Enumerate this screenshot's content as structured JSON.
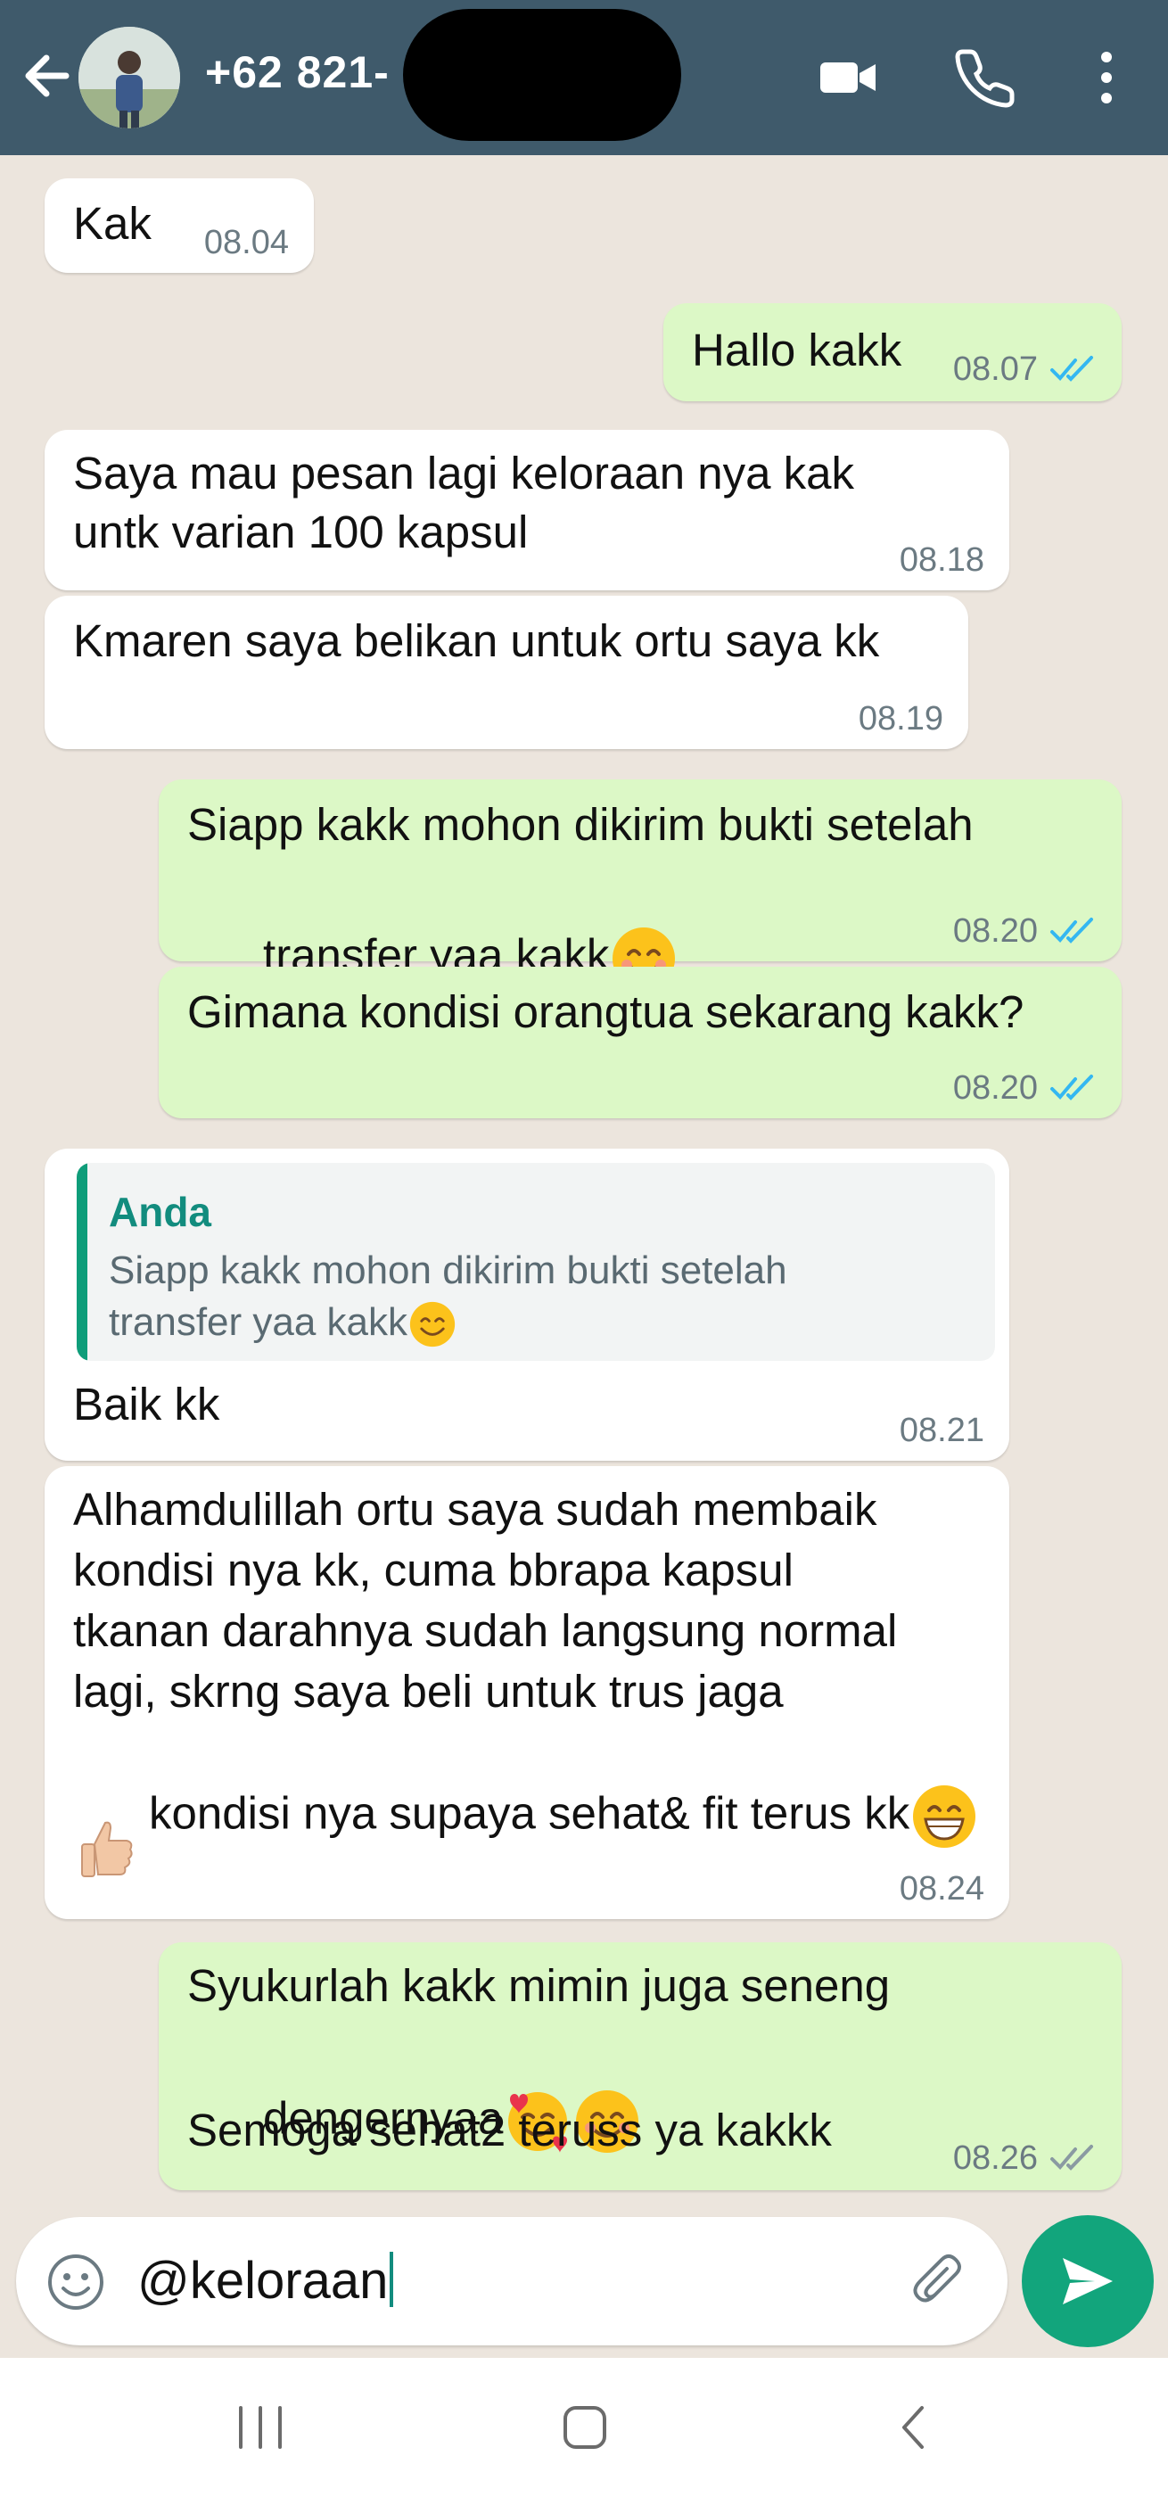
{
  "header": {
    "contact_name": "+62 821-",
    "icons": [
      "back-arrow-icon",
      "video-call-icon",
      "voice-call-icon",
      "more-options-icon"
    ],
    "background_color": "#3f5a6b"
  },
  "messages": [
    {
      "direction": "in",
      "text": "Kak",
      "time": "08.04"
    },
    {
      "direction": "out",
      "text": "Hallo kakk",
      "time": "08.07",
      "status": "read"
    },
    {
      "direction": "in",
      "lines": [
        "Saya mau pesan lagi keloraan nya kak",
        "untk varian 100 kapsul"
      ],
      "time": "08.18"
    },
    {
      "direction": "in",
      "text": "Kmaren saya belikan untuk ortu saya kk",
      "time": "08.19"
    },
    {
      "direction": "out",
      "lines": [
        "Siapp kakk mohon dikirim bukti setelah",
        "transfer yaa kakk"
      ],
      "emoji": "smiling-face-icon",
      "time": "08.20",
      "status": "read"
    },
    {
      "direction": "out",
      "text": "Gimana kondisi orangtua sekarang kakk?",
      "time": "08.20",
      "status": "read"
    },
    {
      "direction": "in",
      "quote": {
        "author": "Anda",
        "lines": [
          "Siapp kakk mohon dikirim bukti setelah",
          "transfer yaa kakk"
        ]
      },
      "text": "Baik kk",
      "time": "08.21"
    },
    {
      "direction": "in",
      "lines": [
        "Alhamdulillah ortu saya sudah membaik",
        "kondisi nya kk, cuma bbrapa kapsul",
        "tkanan darahnya sudah langsung normal",
        "lagi, skrng saya beli untuk trus jaga",
        "kondisi nya supaya sehat& fit terus kk"
      ],
      "emoji": "grinning-face-icon",
      "extra_emoji": "thumbs-up-icon",
      "time": "08.24"
    },
    {
      "direction": "out",
      "lines": [
        "Syukurlah kakk mimin juga seneng",
        "dengernyaa",
        "Semoga sehat2 teruss ya kakkk"
      ],
      "emoji": [
        "smiling-face-with-hearts-icon",
        "smiling-face-icon"
      ],
      "time": "08.26",
      "status": "delivered"
    }
  ],
  "composer": {
    "value": "@keloraan",
    "icons": [
      "emoji-icon",
      "attach-icon",
      "send-icon"
    ]
  },
  "navbar": {
    "icons": [
      "recent-apps-icon",
      "home-icon",
      "back-icon"
    ]
  },
  "colors": {
    "incoming_bubble": "#ffffff",
    "outgoing_bubble": "#dcf8c6",
    "chat_background": "#ece5dd",
    "read_tick": "#34b7f1",
    "accent": "#12a57c"
  }
}
